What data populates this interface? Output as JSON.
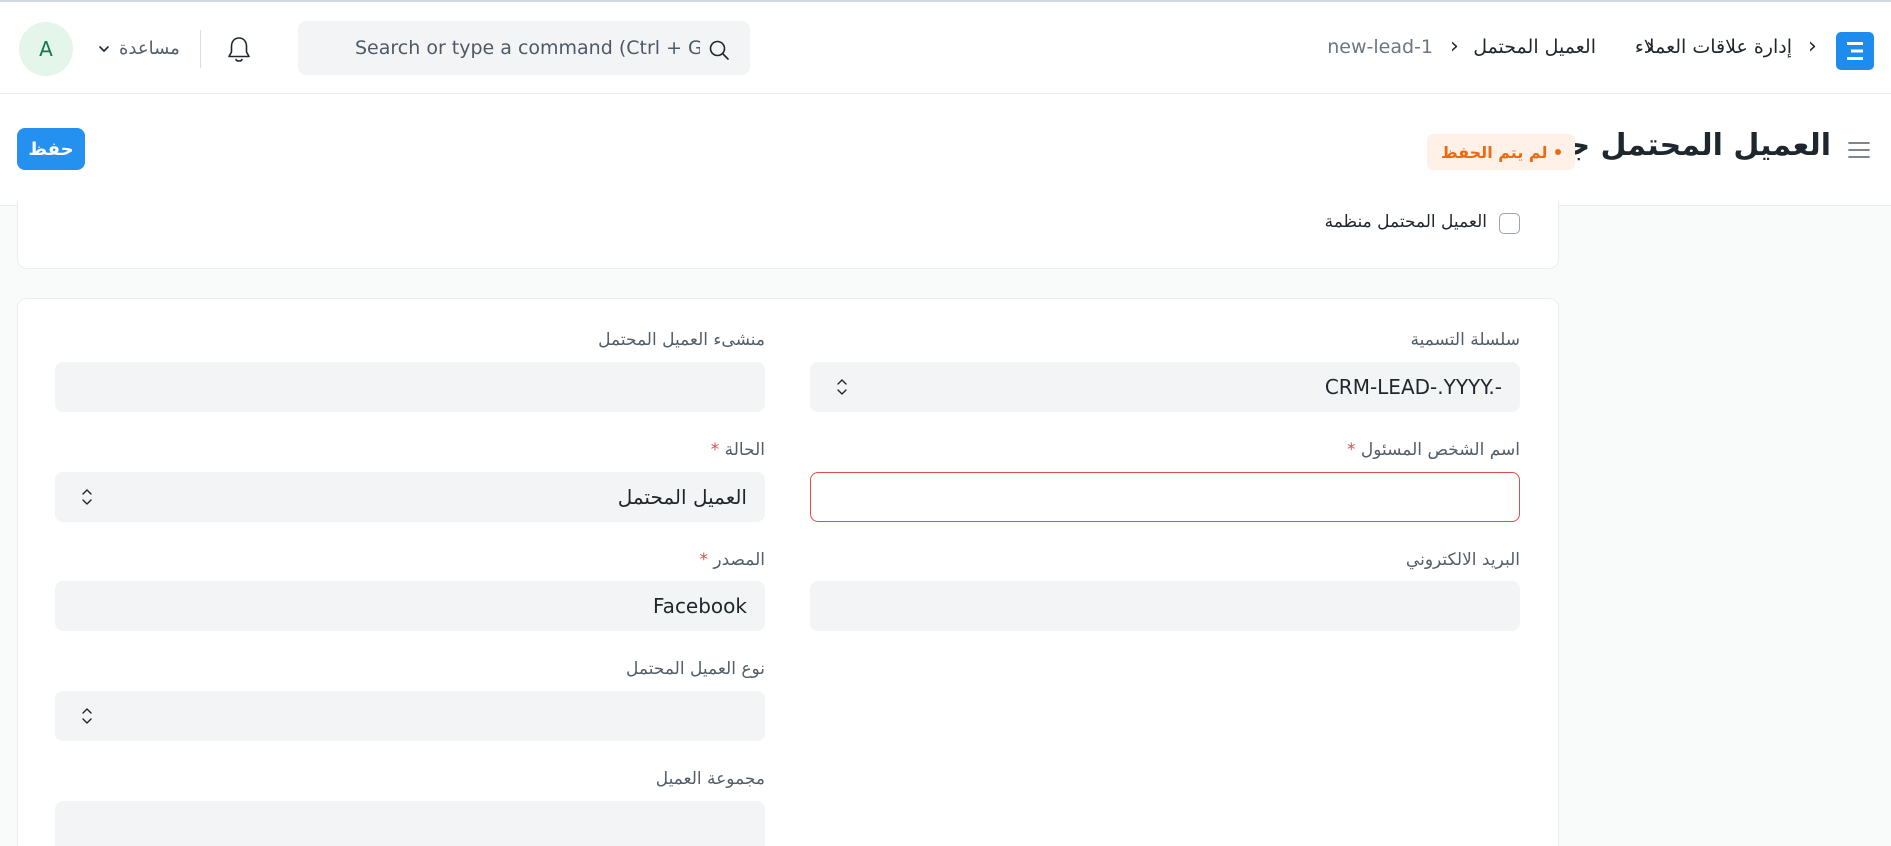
{
  "navbar": {
    "breadcrumbs": [
      "إدارة علاقات العملاء",
      "العميل المحتمل",
      "new-lead-1"
    ],
    "search_placeholder": "Search or type a command (Ctrl + G)",
    "help_label": "مساعدة",
    "avatar_initial": "A",
    "logo_icon": "erpnext-logo-icon"
  },
  "page": {
    "title": "العميل المحتمل جديد",
    "indicator": "لم يتم الحفظ",
    "save_label": "حفظ"
  },
  "org_checkbox": {
    "label": "العميل المحتمل منظمة",
    "checked": false
  },
  "form": {
    "naming_series": {
      "label": "سلسلة التسمية",
      "value": "CRM-LEAD-.YYYY.-"
    },
    "lead_owner": {
      "label": "منشىء العميل المحتمل",
      "value": ""
    },
    "person_name": {
      "label": "اسم الشخص المسئول",
      "required": "*",
      "value": ""
    },
    "status": {
      "label": "الحالة",
      "required": "*",
      "value": "العميل المحتمل"
    },
    "email": {
      "label": "البريد الالكتروني",
      "value": ""
    },
    "source": {
      "label": "المصدر",
      "required": "*",
      "value": "Facebook"
    },
    "lead_type": {
      "label": "نوع العميل المحتمل",
      "value": ""
    },
    "customer_group": {
      "label": "مجموعة العميل",
      "value": ""
    }
  },
  "colors": {
    "primary": "#2490ef",
    "indicator_text": "#e86c13",
    "indicator_bg": "#fff1e7",
    "error_border": "#e24c4c"
  }
}
